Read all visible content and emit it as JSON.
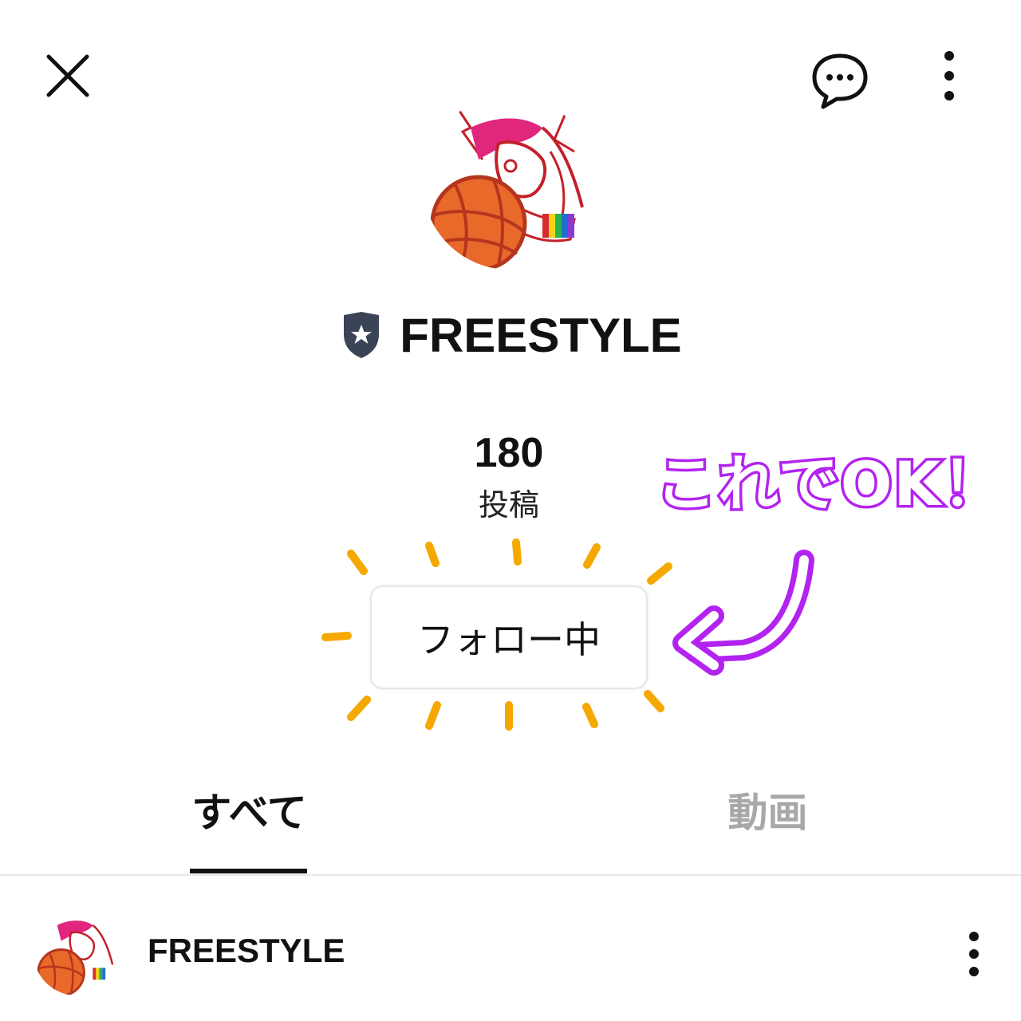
{
  "header": {
    "close_icon": "close-icon",
    "chat_icon": "chat-bubble-icon",
    "more_icon": "more-vertical-icon"
  },
  "profile": {
    "avatar_icon": "basketball-character-avatar",
    "badge_icon": "official-shield-badge-icon",
    "name": "FREESTYLE",
    "post_count": "180",
    "post_label": "投稿",
    "follow_button_label": "フォロー中"
  },
  "annotation": {
    "text": "これでOK！",
    "color": "#b323f0",
    "sparkle_color": "#f5a800"
  },
  "tabs": [
    {
      "label": "すべて",
      "active": true
    },
    {
      "label": "動画",
      "active": false
    }
  ],
  "feed": {
    "post": {
      "author": "FREESTYLE",
      "more_icon": "more-vertical-icon"
    }
  }
}
